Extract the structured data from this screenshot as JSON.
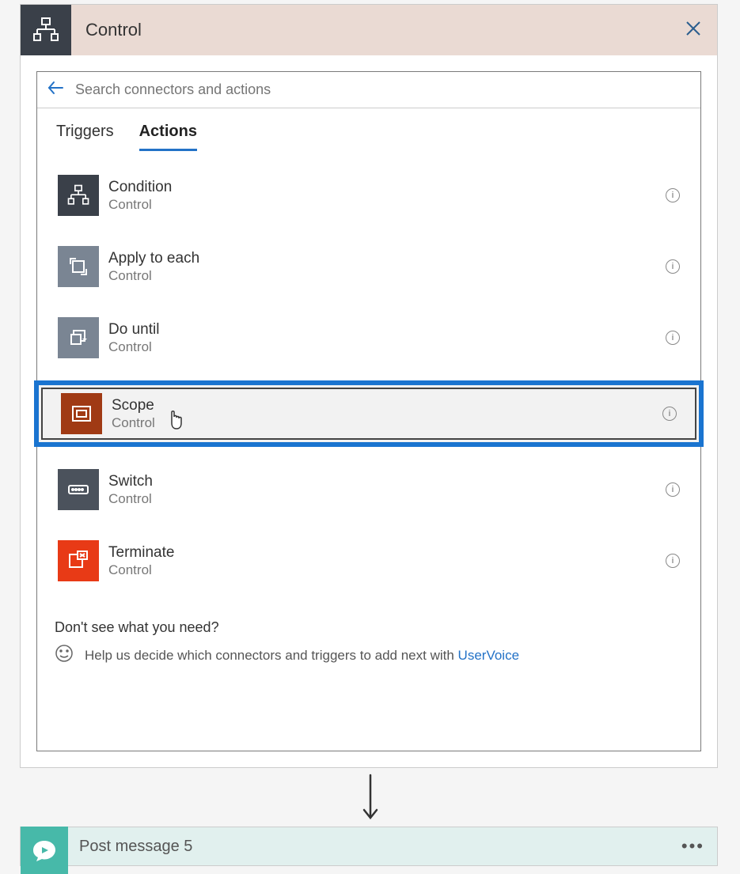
{
  "header": {
    "title": "Control"
  },
  "search": {
    "placeholder": "Search connectors and actions"
  },
  "tabs": {
    "triggers": "Triggers",
    "actions": "Actions"
  },
  "actions": [
    {
      "title": "Condition",
      "subtitle": "Control",
      "icon": "condition",
      "color": "#3a4049"
    },
    {
      "title": "Apply to each",
      "subtitle": "Control",
      "icon": "apply-each",
      "color": "#7a8593"
    },
    {
      "title": "Do until",
      "subtitle": "Control",
      "icon": "do-until",
      "color": "#7a8593"
    },
    {
      "title": "Scope",
      "subtitle": "Control",
      "icon": "scope",
      "color": "#a03a14",
      "highlighted": true
    },
    {
      "title": "Switch",
      "subtitle": "Control",
      "icon": "switch",
      "color": "#4b525c"
    },
    {
      "title": "Terminate",
      "subtitle": "Control",
      "icon": "terminate",
      "color": "#e83a16"
    }
  ],
  "help": {
    "title": "Don't see what you need?",
    "text_prefix": "Help us decide which connectors and triggers to add next with ",
    "link": "UserVoice"
  },
  "next_step": {
    "title": "Post message 5"
  }
}
